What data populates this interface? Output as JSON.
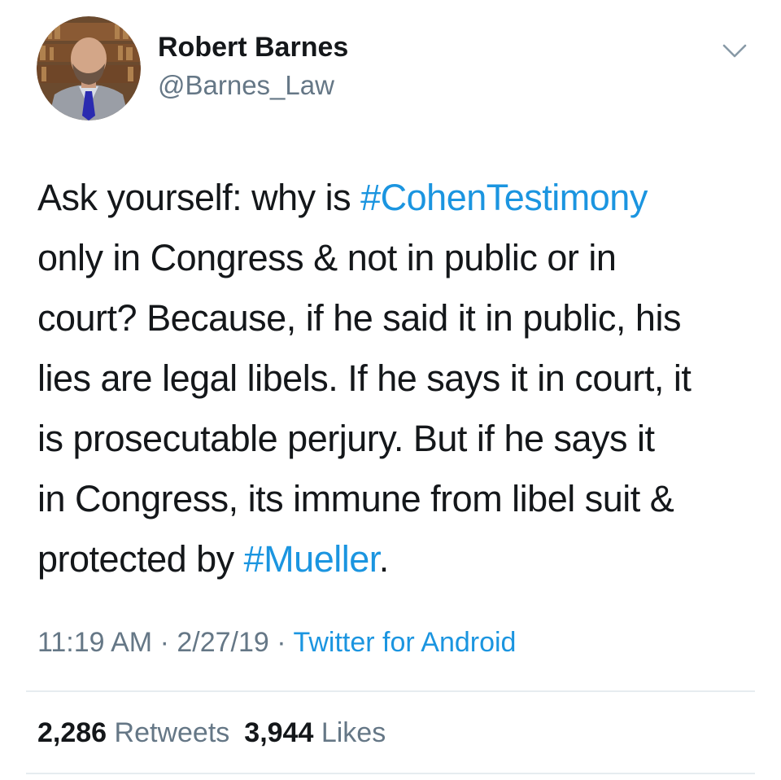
{
  "author": {
    "display_name": "Robert Barnes",
    "handle": "@Barnes_Law",
    "avatar_icon": "profile-photo"
  },
  "menu_icon": "chevron-down-icon",
  "tweet": {
    "lines": [
      [
        {
          "t": "Ask yourself: why is "
        },
        {
          "t": "#CohenTestimony",
          "tag": true
        }
      ],
      [
        {
          "t": "only in Congress & not in public or in"
        }
      ],
      [
        {
          "t": "court? Because, if he said it in public, his"
        }
      ],
      [
        {
          "t": "lies are legal libels. If he says it in court, it"
        }
      ],
      [
        {
          "t": "is prosecutable perjury. But if he says it"
        }
      ],
      [
        {
          "t": "in Congress, its immune from libel suit &"
        }
      ],
      [
        {
          "t": "protected by "
        },
        {
          "t": "#Mueller",
          "tag": true
        },
        {
          "t": "."
        }
      ]
    ]
  },
  "meta": {
    "time": "11:19 AM",
    "date": "2/27/19",
    "separator": "·",
    "source": "Twitter for Android"
  },
  "stats": {
    "retweets_count": "2,286",
    "retweets_label": "Retweets",
    "likes_count": "3,944",
    "likes_label": "Likes"
  },
  "colors": {
    "link": "#1b95e0",
    "secondary_text": "#657786",
    "primary_text": "#14171a",
    "divider": "#e6ecf0"
  }
}
